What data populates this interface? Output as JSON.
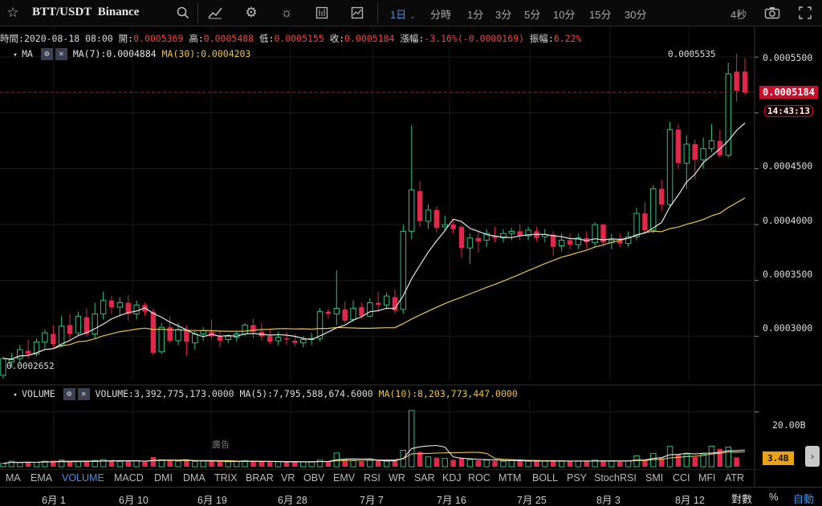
{
  "toolbar": {
    "symbol": "BTT/USDT",
    "exchange": "Binance",
    "intervals": [
      "1日",
      "分時",
      "1分",
      "3分",
      "5分",
      "10分",
      "15分",
      "30分"
    ],
    "active_interval": "1日",
    "refresh": "4秒"
  },
  "ohlc": {
    "time_label": "時間:",
    "time": "2020-08-18 08:00",
    "open_label": "開:",
    "open": "0.0005369",
    "high_label": "高:",
    "high": "0.0005488",
    "low_label": "低:",
    "low": "0.0005155",
    "close_label": "收:",
    "close": "0.0005184",
    "change_label": "漲幅:",
    "change": "-3.16%(-0.0000169)",
    "amp_label": "振幅:",
    "amp": "6.22%"
  },
  "ma_row": {
    "name": "MA",
    "ma7": "MA(7):0.0004884",
    "ma30": "MA(30):0.0004203"
  },
  "vol_row": {
    "name": "VOLUME",
    "volume": "VOLUME:3,392,775,173.0000",
    "ma5": "MA(5):7,795,588,674.6000",
    "ma10": "MA(10):8,203,773,447.0000"
  },
  "price_axis": [
    "0.0005500",
    "0.0005000",
    "0.0004500",
    "0.0004000",
    "0.0003500",
    "0.0003000"
  ],
  "last_price": "0.0005184",
  "countdown": "14:43:13",
  "high_marker": "0.0005535",
  "low_marker": "0.0002652",
  "volume_axis": [
    "20.00B"
  ],
  "last_volume": "3.4B",
  "ad_label": "廣告",
  "indicators": [
    "MA",
    "EMA",
    "VOLUME",
    "MACD",
    "DMI",
    "DMA",
    "TRIX",
    "BRAR",
    "VR",
    "OBV",
    "EMV",
    "RSI",
    "WR",
    "SAR",
    "KDJ",
    "ROC",
    "MTM",
    "BOLL",
    "PSY",
    "StochRSI",
    "SMI",
    "CCI",
    "MFI",
    "ATR"
  ],
  "active_indicator": "VOLUME",
  "dates": [
    "6月 1",
    "6月 10",
    "6月 19",
    "6月 28",
    "7月 7",
    "7月 16",
    "7月 25",
    "8月 3",
    "8月 12"
  ],
  "bottom_buttons": {
    "log": "對數",
    "pct": "%",
    "auto": "自動"
  },
  "colors": {
    "up": "#2ebd85",
    "down": "#e0294a",
    "ma7": "#e6e6e6",
    "ma30": "#e8c547",
    "accent": "#4a90e2"
  },
  "chart_data": {
    "type": "candlestick",
    "x_start": "2020-05-27",
    "x_end": "2020-08-18",
    "candles": [
      [
        0.000265,
        0.000282,
        0.00028,
        0.000262
      ],
      [
        0.000277,
        0.000285,
        0.000279,
        0.000272
      ],
      [
        0.00028,
        0.000292,
        0.000288,
        0.000276
      ],
      [
        0.000287,
        0.000297,
        0.000284,
        0.00028
      ],
      [
        0.000284,
        0.000298,
        0.000295,
        0.000282
      ],
      [
        0.000295,
        0.000306,
        0.000303,
        0.000289
      ],
      [
        0.000302,
        0.00031,
        0.000293,
        0.00029
      ],
      [
        0.000292,
        0.000318,
        0.000309,
        0.00029
      ],
      [
        0.00031,
        0.00032,
        0.000302,
        0.000295
      ],
      [
        0.000303,
        0.000322,
        0.000318,
        0.0003
      ],
      [
        0.000317,
        0.000325,
        0.000302,
        0.0003
      ],
      [
        0.000302,
        0.00033,
        0.00032,
        0.000298
      ],
      [
        0.00032,
        0.00034,
        0.000332,
        0.000315
      ],
      [
        0.000332,
        0.000336,
        0.000326,
        0.00032
      ],
      [
        0.000326,
        0.000335,
        0.00033,
        0.000318
      ],
      [
        0.00033,
        0.000337,
        0.00032,
        0.000314
      ],
      [
        0.00032,
        0.000332,
        0.000328,
        0.000315
      ],
      [
        0.000328,
        0.00033,
        0.000322,
        0.000318
      ],
      [
        0.000322,
        0.000325,
        0.000285,
        0.000283
      ],
      [
        0.000286,
        0.000312,
        0.000308,
        0.000284
      ],
      [
        0.000308,
        0.000318,
        0.000296,
        0.000294
      ],
      [
        0.000296,
        0.000312,
        0.000306,
        0.000292
      ],
      [
        0.000306,
        0.00031,
        0.000295,
        0.000282
      ],
      [
        0.000294,
        0.000305,
        0.000302,
        0.000288
      ],
      [
        0.000302,
        0.000308,
        0.000305,
        0.000296
      ],
      [
        0.000304,
        0.000315,
        0.0003,
        0.000297
      ],
      [
        0.0003,
        0.000305,
        0.000296,
        0.00029
      ],
      [
        0.000297,
        0.000302,
        0.0003,
        0.000294
      ],
      [
        0.000299,
        0.000305,
        0.000302,
        0.000295
      ],
      [
        0.000302,
        0.000312,
        0.00031,
        0.0003
      ],
      [
        0.00031,
        0.000316,
        0.000304,
        0.000298
      ],
      [
        0.000304,
        0.000312,
        0.0003,
        0.000296
      ],
      [
        0.0003,
        0.000306,
        0.000295,
        0.000293
      ],
      [
        0.000296,
        0.000304,
        0.000299,
        0.000292
      ],
      [
        0.000298,
        0.000304,
        0.000297,
        0.000292
      ],
      [
        0.000296,
        0.000302,
        0.000294,
        0.000291
      ],
      [
        0.000294,
        0.0003,
        0.000297,
        0.00029
      ],
      [
        0.000297,
        0.000303,
        0.000298,
        0.000292
      ],
      [
        0.000298,
        0.000325,
        0.000322,
        0.000296
      ],
      [
        0.000322,
        0.000325,
        0.00032,
        0.000316
      ],
      [
        0.00032,
        0.000359,
        0.000325,
        0.00031
      ],
      [
        0.000324,
        0.000331,
        0.000314,
        0.000312
      ],
      [
        0.000315,
        0.000332,
        0.000325,
        0.000313
      ],
      [
        0.000326,
        0.00033,
        0.000318,
        0.000316
      ],
      [
        0.000318,
        0.000334,
        0.00033,
        0.000317
      ],
      [
        0.00033,
        0.00034,
        0.000328,
        0.000322
      ],
      [
        0.000328,
        0.000339,
        0.000336,
        0.000324
      ],
      [
        0.000335,
        0.000342,
        0.000323,
        0.00032
      ],
      [
        0.000324,
        0.0004,
        0.000394,
        0.00032
      ],
      [
        0.000394,
        0.000489,
        0.000431,
        0.000387
      ],
      [
        0.00043,
        0.000439,
        0.000403,
        0.000398
      ],
      [
        0.000403,
        0.000418,
        0.000413,
        0.000396
      ],
      [
        0.000413,
        0.000416,
        0.000397,
        0.000393
      ],
      [
        0.000398,
        0.000408,
        0.0004,
        0.000395
      ],
      [
        0.0004,
        0.000404,
        0.000396,
        0.000392
      ],
      [
        0.000398,
        0.000399,
        0.000379,
        0.00037
      ],
      [
        0.000379,
        0.000392,
        0.000388,
        0.000365
      ],
      [
        0.000388,
        0.000394,
        0.000385,
        0.000375
      ],
      [
        0.000386,
        0.000396,
        0.000392,
        0.00038
      ],
      [
        0.00039,
        0.000398,
        0.000388,
        0.000384
      ],
      [
        0.000388,
        0.000396,
        0.000392,
        0.000384
      ],
      [
        0.000392,
        0.000397,
        0.000394,
        0.000386
      ],
      [
        0.000394,
        0.0004,
        0.00039,
        0.000386
      ],
      [
        0.00039,
        0.000398,
        0.000395,
        0.000386
      ],
      [
        0.000394,
        0.000398,
        0.000388,
        0.000385
      ],
      [
        0.000389,
        0.000396,
        0.000391,
        0.000384
      ],
      [
        0.000391,
        0.000394,
        0.00038,
        0.000372
      ],
      [
        0.000381,
        0.000392,
        0.000386,
        0.000376
      ],
      [
        0.000386,
        0.000392,
        0.000382,
        0.000378
      ],
      [
        0.000382,
        0.000392,
        0.000388,
        0.000378
      ],
      [
        0.000388,
        0.000394,
        0.000384,
        0.000378
      ],
      [
        0.000384,
        0.000402,
        0.0004,
        0.00038
      ],
      [
        0.0004,
        0.000401,
        0.000384,
        0.00038
      ],
      [
        0.000384,
        0.000392,
        0.000386,
        0.000378
      ],
      [
        0.000386,
        0.000392,
        0.000383,
        0.00038
      ],
      [
        0.000383,
        0.000394,
        0.000389,
        0.00038
      ],
      [
        0.000389,
        0.000415,
        0.00041,
        0.000386
      ],
      [
        0.00041,
        0.00042,
        0.000395,
        0.000392
      ],
      [
        0.000395,
        0.000435,
        0.000432,
        0.000392
      ],
      [
        0.000432,
        0.00044,
        0.000418,
        0.000412
      ],
      [
        0.000418,
        0.000492,
        0.000485,
        0.000416
      ],
      [
        0.000485,
        0.00049,
        0.000455,
        0.00045
      ],
      [
        0.000455,
        0.00048,
        0.000472,
        0.000432
      ],
      [
        0.000472,
        0.000476,
        0.000458,
        0.00044
      ],
      [
        0.000458,
        0.000478,
        0.000468,
        0.00045
      ],
      [
        0.000468,
        0.00049,
        0.000475,
        0.000465
      ],
      [
        0.000475,
        0.000485,
        0.000462,
        0.00046
      ],
      [
        0.000462,
        0.000545,
        0.000535,
        0.00046
      ],
      [
        0.000537,
        0.000553,
        0.00052,
        0.00051
      ],
      [
        0.000537,
        0.000549,
        0.000518,
        0.000516
      ]
    ],
    "volume": [
      1.2,
      2.0,
      1.5,
      1.8,
      1.6,
      2.0,
      2.2,
      2.4,
      1.7,
      1.9,
      2.0,
      2.3,
      2.6,
      2.1,
      1.9,
      2.0,
      2.2,
      1.8,
      3.5,
      2.5,
      2.2,
      2.0,
      2.4,
      1.9,
      2.1,
      2.0,
      1.9,
      1.8,
      1.9,
      2.2,
      2.0,
      1.8,
      1.7,
      1.8,
      1.6,
      1.9,
      1.8,
      1.7,
      2.4,
      1.9,
      5.0,
      2.8,
      2.2,
      2.0,
      2.3,
      2.2,
      2.0,
      2.4,
      6.0,
      20.5,
      5.4,
      3.6,
      3.3,
      3.0,
      2.5,
      3.1,
      2.6,
      2.3,
      2.4,
      2.2,
      2.0,
      2.3,
      2.1,
      2.0,
      1.9,
      2.1,
      2.4,
      2.0,
      1.9,
      2.0,
      2.1,
      2.4,
      2.2,
      2.0,
      1.8,
      2.1,
      4.0,
      2.4,
      4.8,
      3.2,
      7.4,
      4.6,
      4.6,
      3.5,
      4.5,
      7.5,
      6.5,
      7.2,
      3.4
    ],
    "ylim": [
      0.00026,
      0.000558
    ],
    "volume_ylim": [
      0,
      24
    ]
  }
}
